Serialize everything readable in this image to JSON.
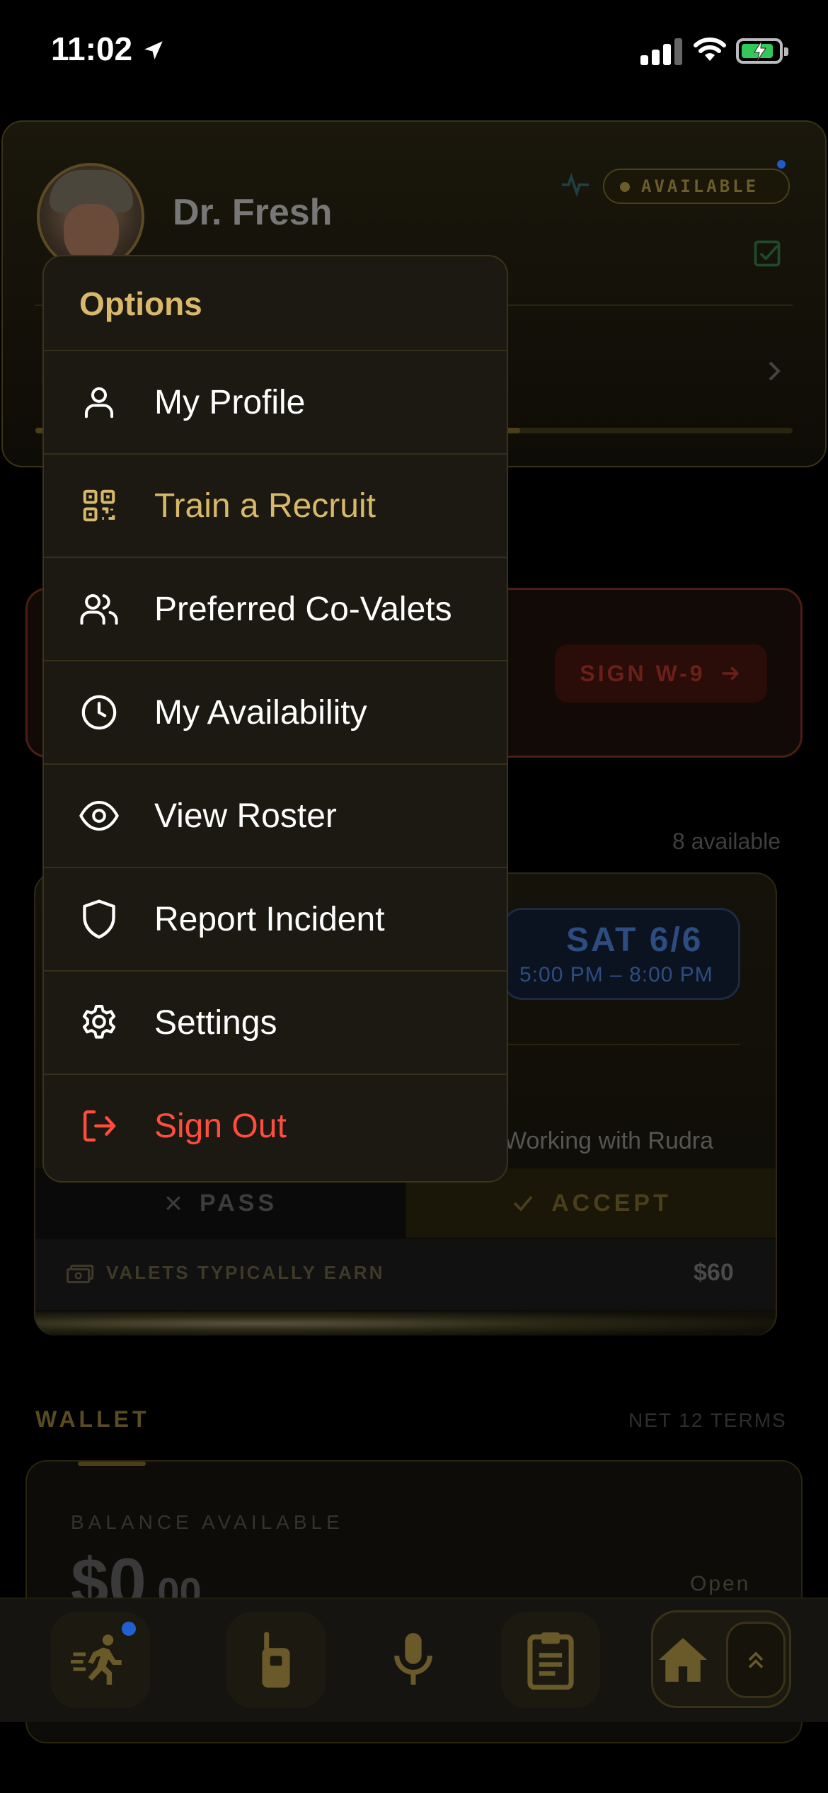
{
  "status_bar": {
    "time": "11:02"
  },
  "profile": {
    "name": "Dr. Fresh",
    "status_badge": "AVAILABLE",
    "progress_fraction": 0.64
  },
  "alert": {
    "cta": "SIGN W-9"
  },
  "gigs": {
    "available_count": "8 available",
    "card": {
      "date": "SAT 6/6",
      "time_range": "5:00 PM – 8:00 PM",
      "working_with": "Working with Rudra",
      "pass_label": "PASS",
      "accept_label": "ACCEPT",
      "earn_label": "VALETS TYPICALLY EARN",
      "earn_value": "$60"
    }
  },
  "wallet": {
    "heading": "WALLET",
    "terms": "NET 12 TERMS",
    "balance_label": "BALANCE AVAILABLE",
    "balance_dollars": "$0",
    "balance_cents": ".00",
    "open_label": "Open"
  },
  "menu": {
    "title": "Options",
    "items": [
      {
        "label": "My Profile",
        "icon": "person-icon",
        "tone": "default"
      },
      {
        "label": "Train a Recruit",
        "icon": "qr-code-icon",
        "tone": "gold"
      },
      {
        "label": "Preferred Co-Valets",
        "icon": "users-icon",
        "tone": "default"
      },
      {
        "label": "My Availability",
        "icon": "clock-icon",
        "tone": "default"
      },
      {
        "label": "View Roster",
        "icon": "eye-icon",
        "tone": "default"
      },
      {
        "label": "Report Incident",
        "icon": "shield-icon",
        "tone": "default"
      },
      {
        "label": "Settings",
        "icon": "gear-icon",
        "tone": "default"
      },
      {
        "label": "Sign Out",
        "icon": "sign-out-icon",
        "tone": "red"
      }
    ]
  },
  "bottom_nav": {
    "items": [
      "running-person-icon",
      "walkie-talkie-icon",
      "microphone-icon",
      "clipboard-icon",
      "home-icon",
      "chevrons-up-icon"
    ]
  },
  "colors": {
    "accent_gold": "#d8b86a",
    "danger_red": "#ff4d3d",
    "background": "#000000",
    "menu_bg": "#1b1911"
  }
}
